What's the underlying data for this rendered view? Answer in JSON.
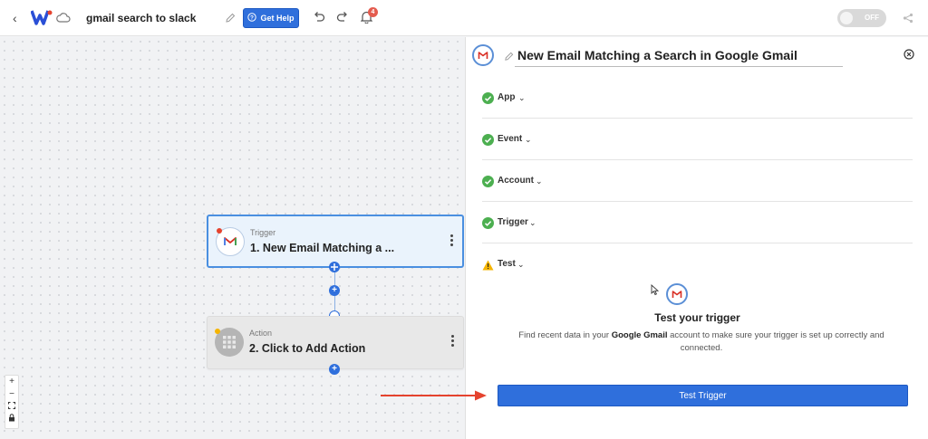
{
  "topbar": {
    "back_icon": "chevron-left-icon",
    "flow_name": "gmail search to slack",
    "help_label": "Get Help",
    "notification_count": "4",
    "toggle_label": "OFF",
    "accent": "#2f6fdc"
  },
  "canvas": {
    "trigger": {
      "type_label": "Trigger",
      "title": "1. New Email Matching a ..."
    },
    "action": {
      "type_label": "Action",
      "title": "2. Click to Add Action"
    },
    "zoom_controls": [
      "+",
      "−",
      "⛶",
      "🔒"
    ]
  },
  "panel": {
    "title": "New Email Matching a Search in Google Gmail",
    "steps": [
      {
        "label": "App",
        "status": "complete"
      },
      {
        "label": "Event",
        "status": "complete"
      },
      {
        "label": "Account",
        "status": "complete"
      },
      {
        "label": "Trigger",
        "status": "complete"
      },
      {
        "label": "Test",
        "status": "warning"
      }
    ],
    "test": {
      "title": "Test your trigger",
      "desc_pre": "Find recent data in your ",
      "desc_bold": "Google Gmail",
      "desc_post": " account to make sure your trigger is set up correctly and connected.",
      "button_label": "Test Trigger"
    }
  },
  "colors": {
    "success": "#4caf50",
    "warning": "#f5b400",
    "annotation_arrow": "#e5432e"
  }
}
